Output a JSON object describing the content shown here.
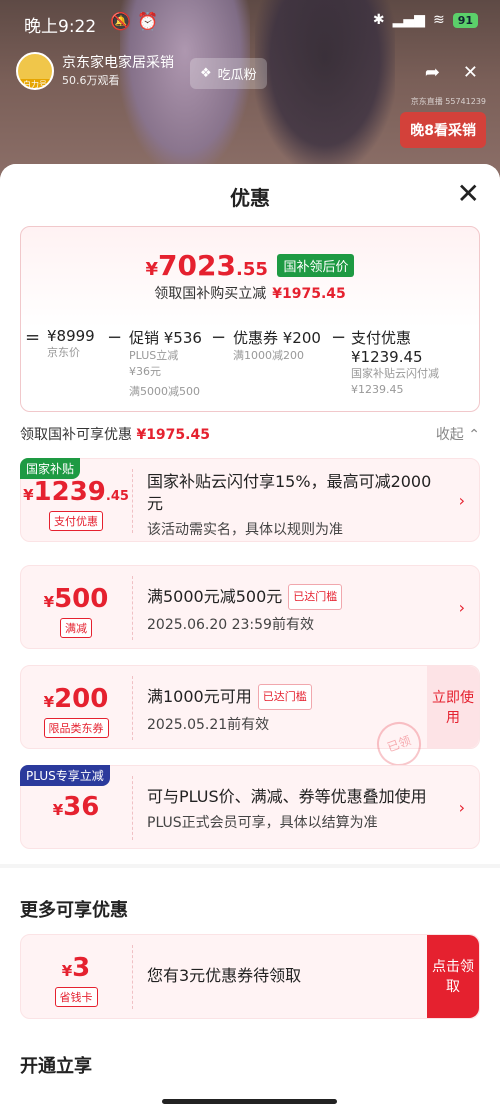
{
  "status": {
    "time": "晚上9:22",
    "battery": "91"
  },
  "live": {
    "avatar_tag": "白力号",
    "name": "京东家电家居采销",
    "viewers": "50.6万观看",
    "chip": "吃瓜粉",
    "room_id": "京东直播 55741239",
    "badge": "晚8看采销"
  },
  "sheet": {
    "title": "优惠"
  },
  "price": {
    "yen": "¥",
    "integer": "7023",
    "decimal": ".55",
    "tag": "国补领后价",
    "save_label": "领取国补购买立减",
    "save_amount": "¥1975.45"
  },
  "formula": {
    "eq": "=",
    "items": [
      {
        "value": "¥8999",
        "sub1": "京东价",
        "sub2": "",
        "sub3": ""
      },
      {
        "value": "促销 ¥536",
        "sub1": "PLUS立减",
        "sub2": "¥36元",
        "sub3": "满5000减500"
      },
      {
        "value": "优惠券 ¥200",
        "sub1": "满1000减200",
        "sub2": "",
        "sub3": ""
      },
      {
        "value": "支付优惠 ¥1239.45",
        "sub1": "国家补贴云闪付减",
        "sub2": "¥1239.45",
        "sub3": ""
      }
    ],
    "minus": "−"
  },
  "section": {
    "label": "领取国补可享优惠",
    "amount": "¥1975.45",
    "collapse": "收起 ⌃"
  },
  "coupons": [
    {
      "corner": "国家补贴",
      "yen": "¥",
      "amount": "1239",
      "dec": ".45",
      "label": "支付优惠",
      "title": "国家补贴云闪付享15%，最高可减2000元",
      "sub": "该活动需实名，具体以规则为准"
    },
    {
      "yen": "¥",
      "amount": "500",
      "label": "满减",
      "title": "满5000元减500元",
      "reach": "已达门槛",
      "sub": "2025.06.20 23:59前有效"
    },
    {
      "yen": "¥",
      "amount": "200",
      "label": "限品类东券",
      "title": "满1000元可用",
      "reach": "已达门槛",
      "sub": "2025.05.21前有效",
      "action": "立即使用",
      "stamp": "已领"
    },
    {
      "corner": "PLUS专享立减",
      "yen": "¥",
      "amount": "36",
      "title": "可与PLUS价、满减、券等优惠叠加使用",
      "sub": "PLUS正式会员可享，具体以结算为准"
    }
  ],
  "more": {
    "title": "更多可享优惠",
    "card": {
      "yen": "¥",
      "amount": "3",
      "label": "省钱卡",
      "title": "您有3元优惠券待领取",
      "action": "点击领取"
    }
  },
  "open": {
    "title": "开通立享"
  }
}
